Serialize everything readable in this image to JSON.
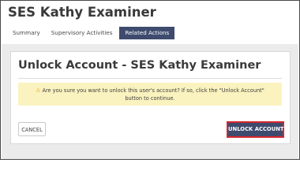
{
  "header": {
    "title": "SES Kathy Examiner"
  },
  "tabs": [
    {
      "label": "Summary",
      "active": false
    },
    {
      "label": "Supervisory Activities",
      "active": false
    },
    {
      "label": "Related Actions",
      "active": true
    }
  ],
  "dialog": {
    "title": "Unlock Account - SES Kathy Examiner",
    "warning_icon": "warning-triangle-icon",
    "message_line1": "Are you sure you want to unlock this user's account? If so, click the \"Unlock Account\"",
    "message_line2": "button to continue.",
    "cancel_label": "CANCEL",
    "unlock_label": "UNLOCK ACCOUNT"
  },
  "colors": {
    "accent": "#3e4b6e",
    "highlight_border": "#d7262c",
    "alert_bg": "#fbf3bf",
    "warning": "#e0a020"
  }
}
